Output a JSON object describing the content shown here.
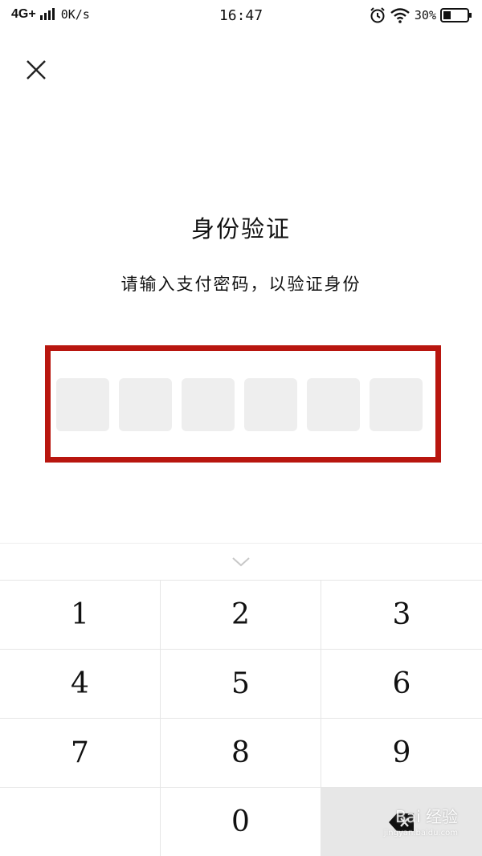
{
  "status_bar": {
    "network": "4G+",
    "speed": "0K/s",
    "time": "16:47",
    "battery_percent": "30%",
    "icons": [
      "signal-icon",
      "alarm-icon",
      "wifi-icon",
      "battery-icon"
    ]
  },
  "header": {
    "close_icon": "close-icon"
  },
  "main": {
    "title": "身份验证",
    "subtitle": "请输入支付密码，以验证身份",
    "pin_length": 6,
    "highlight_color": "#b8160f"
  },
  "keypad": {
    "collapse_icon": "chevron-down-icon",
    "keys": [
      "1",
      "2",
      "3",
      "4",
      "5",
      "6",
      "7",
      "8",
      "9",
      "",
      "0",
      "backspace"
    ],
    "watermark": {
      "main": "Bai 经验",
      "sub": "jingyan.baidu.com"
    }
  }
}
